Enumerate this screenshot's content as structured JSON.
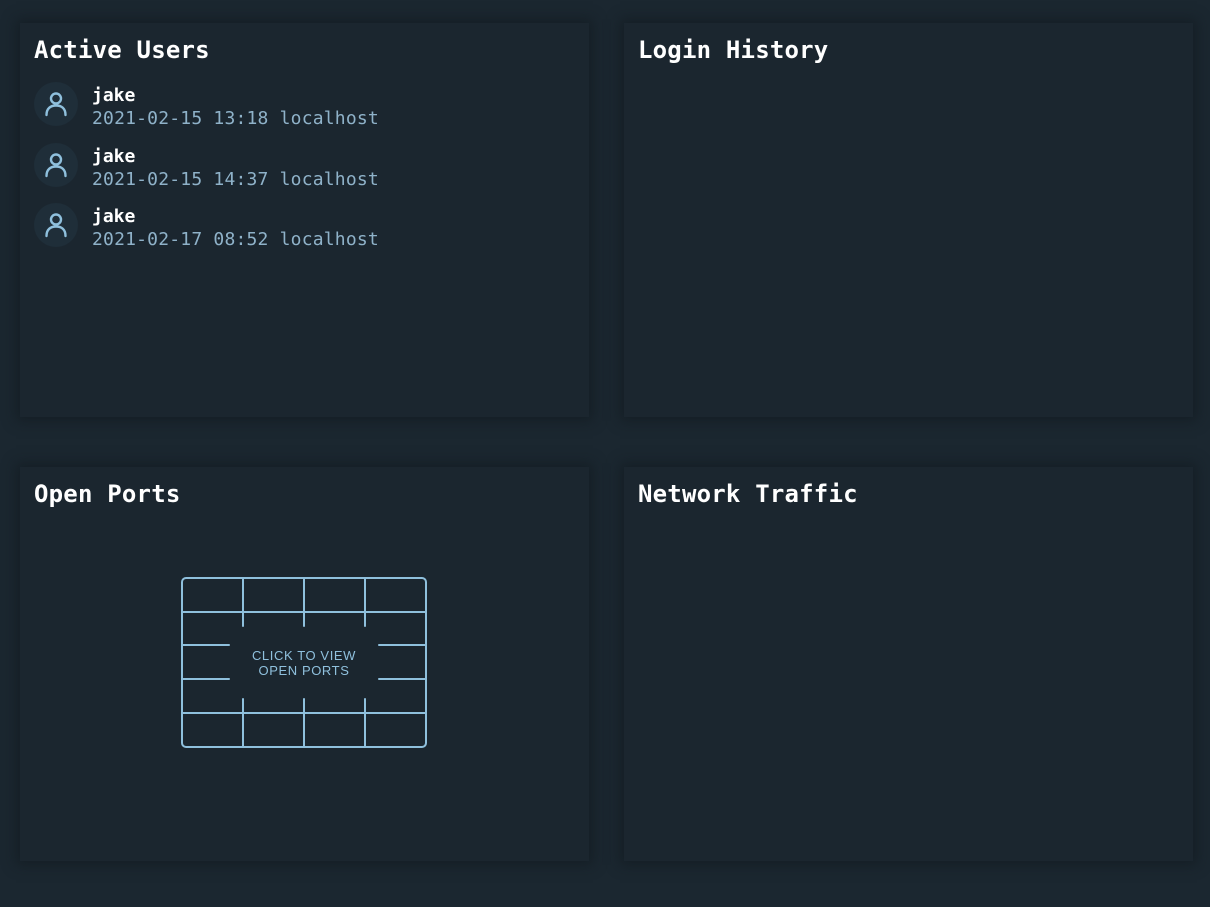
{
  "panels": {
    "active_users": {
      "title": "Active Users",
      "users": [
        {
          "name": "jake",
          "meta": "2021-02-15 13:18 localhost"
        },
        {
          "name": "jake",
          "meta": "2021-02-15 14:37 localhost"
        },
        {
          "name": "jake",
          "meta": "2021-02-17 08:52 localhost"
        }
      ]
    },
    "login_history": {
      "title": "Login History"
    },
    "open_ports": {
      "title": "Open Ports",
      "button_line1": "CLICK TO VIEW",
      "button_line2": "OPEN PORTS"
    },
    "network_traffic": {
      "title": "Network Traffic"
    }
  },
  "icons": {
    "user": "user-icon",
    "ports": "port-grid-icon"
  },
  "colors": {
    "background": "#1b2730",
    "panel": "#1b262f",
    "accent": "#8fc0dd",
    "muted_text": "#8fb2c9",
    "text": "#ffffff"
  }
}
